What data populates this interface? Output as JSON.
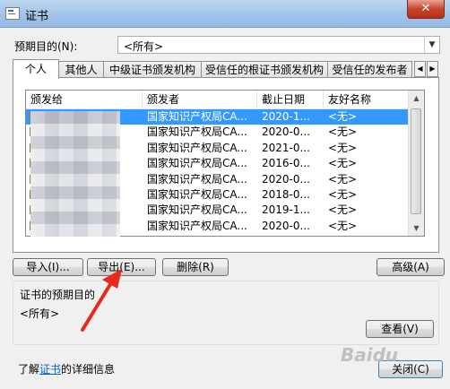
{
  "window": {
    "title": "证书",
    "close_label": "✕"
  },
  "purpose": {
    "label": "预期目的(N):",
    "value": "<所有>"
  },
  "tabs": [
    {
      "label": "个人",
      "active": true
    },
    {
      "label": "其他人",
      "active": false
    },
    {
      "label": "中级证书颁发机构",
      "active": false
    },
    {
      "label": "受信任的根证书颁发机构",
      "active": false
    },
    {
      "label": "受信任的发布者",
      "active": false
    }
  ],
  "tab_scroll": {
    "left": "◀",
    "right": "▶"
  },
  "columns": [
    "颁发给",
    "颁发者",
    "截止日期",
    "友好名称"
  ],
  "rows": [
    {
      "issuer": "国家知识产权局CA...",
      "expiry": "2020-1...",
      "friendly": "<无>",
      "selected": true
    },
    {
      "issuer": "国家知识产权局CA...",
      "expiry": "2020-0...",
      "friendly": "<无>",
      "selected": false
    },
    {
      "issuer": "国家知识产权局CA...",
      "expiry": "2021-0...",
      "friendly": "<无>",
      "selected": false
    },
    {
      "issuer": "国家知识产权局CA...",
      "expiry": "2016-0...",
      "friendly": "<无>",
      "selected": false
    },
    {
      "issuer": "国家知识产权局CA...",
      "expiry": "2020-0...",
      "friendly": "<无>",
      "selected": false
    },
    {
      "issuer": "国家知识产权局CA...",
      "expiry": "2018-0...",
      "friendly": "<无>",
      "selected": false
    },
    {
      "issuer": "国家知识产权局CA...",
      "expiry": "2019-1...",
      "friendly": "<无>",
      "selected": false
    },
    {
      "issuer": "国家知识产权局CA...",
      "expiry": "2020-0...",
      "friendly": "<无>",
      "selected": false
    }
  ],
  "buttons": {
    "import": "导入(I)...",
    "export": "导出(E)...",
    "delete": "删除(R)",
    "advanced": "高级(A)",
    "view": "查看(V)",
    "close": "关闭(C)"
  },
  "cert_purpose": {
    "heading": "证书的预期目的",
    "value": "<所有>"
  },
  "footer": {
    "prefix": "了解",
    "link": "证书",
    "suffix": "的详细信息"
  },
  "watermark": "Baidu",
  "colors": {
    "selection": "#3399ff",
    "arrow": "#e8291c",
    "link": "#0066cc"
  }
}
